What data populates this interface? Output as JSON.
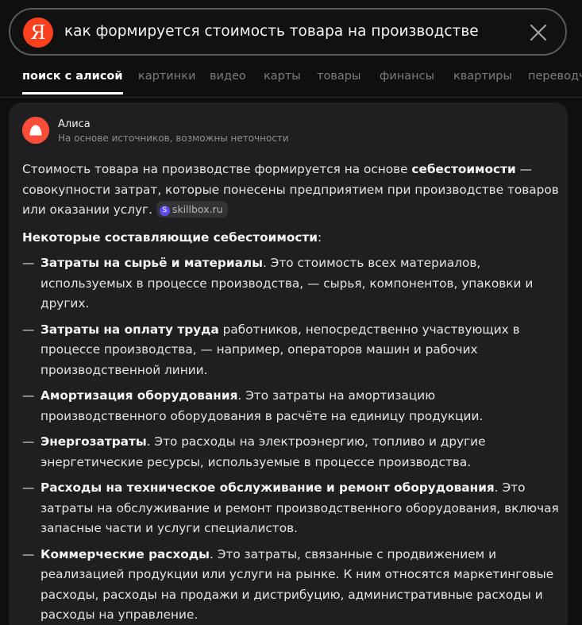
{
  "search": {
    "logo_letter": "Я",
    "query": "как формируется стоимость товара на производстве",
    "brand_color": "#fc3f1d"
  },
  "tabs": [
    {
      "label": "поиск с алисой",
      "active": true
    },
    {
      "label": "картинки"
    },
    {
      "label": "видео"
    },
    {
      "label": "карты"
    },
    {
      "label": "товары"
    },
    {
      "label": "финансы"
    },
    {
      "label": "квартиры"
    },
    {
      "label": "переводч"
    }
  ],
  "answer": {
    "author": "Алиса",
    "disclaimer": "На основе источников, возможны неточности",
    "intro": {
      "text_before": "Стоимость товара на производстве формируется на основе ",
      "bold": "себестоимости",
      "text_after": " — совокупности затрат, которые понесены предприятием при производстве товаров или оказании услуг. ",
      "source_icon_letter": "S",
      "source": "skillbox.ru"
    },
    "section_title": {
      "bold": "Некоторые составляющие себестоимости",
      "suffix": ":"
    },
    "dash": "—",
    "items": [
      {
        "bold": "Затраты на сырьё и материалы",
        "text": ". Это стоимость всех материалов, используемых в процессе производства, — сырья, компонентов, упаковки и других."
      },
      {
        "bold": "Затраты на оплату труда",
        "text": " работников, непосредственно участвующих в процессе производства, — например, операторов машин и рабочих производственной линии."
      },
      {
        "bold": "Амортизация оборудования",
        "text": ". Это затраты на амортизацию производственного оборудования в расчёте на единицу продукции."
      },
      {
        "bold": "Энергозатраты",
        "text": ". Это расходы на электроэнергию, топливо и другие энергетические ресурсы, используемые в процессе производства."
      },
      {
        "bold": "Расходы на техническое обслуживание и ремонт оборудования",
        "text": ". Это затраты на обслуживание и ремонт производственного оборудования, включая запасные части и услуги специалистов."
      },
      {
        "bold": "Коммерческие расходы",
        "text": ". Это затраты, связанные с продвижением и реализацией продукции или услуги на рынке. К ним относятся маркетинговые расходы, расходы на продажи и дистрибуцию, административные расходы и расходы на управление."
      }
    ]
  }
}
